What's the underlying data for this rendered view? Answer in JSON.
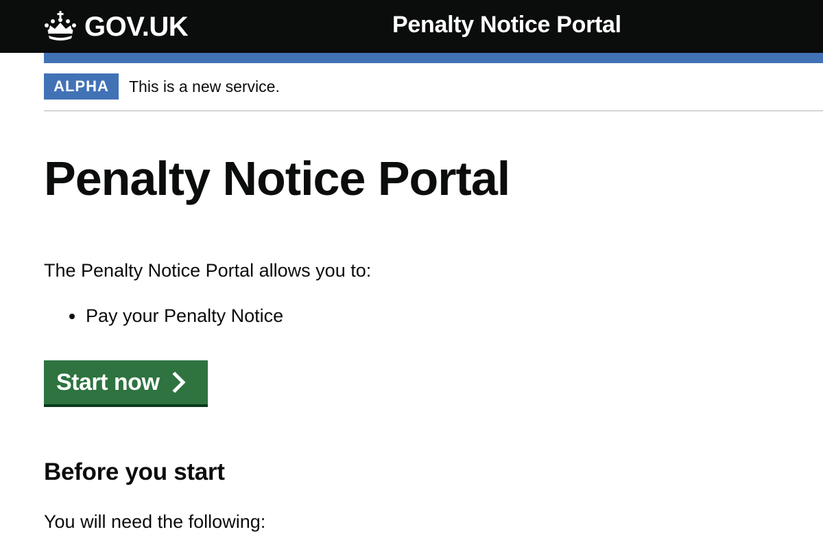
{
  "header": {
    "logo_text": "GOV.UK",
    "logo_icon": "crown-icon",
    "service_name": "Penalty Notice Portal"
  },
  "phase_banner": {
    "tag": "ALPHA",
    "text": "This is a new service."
  },
  "main": {
    "title": "Penalty Notice Portal",
    "intro": "The Penalty Notice Portal allows you to:",
    "list": [
      {
        "text": "Pay your Penalty Notice"
      }
    ],
    "start_button": {
      "label": "Start now",
      "icon": "chevron-right-icon"
    },
    "before_heading": "Before you start",
    "before_text": "You will need the following:"
  },
  "colors": {
    "header_bg": "#0b0c0c",
    "accent_blue": "#4272b6",
    "button_green": "#2e7340",
    "button_shadow": "#0b3a1c",
    "text": "#0b0c0c",
    "divider": "#b1b4b6"
  }
}
